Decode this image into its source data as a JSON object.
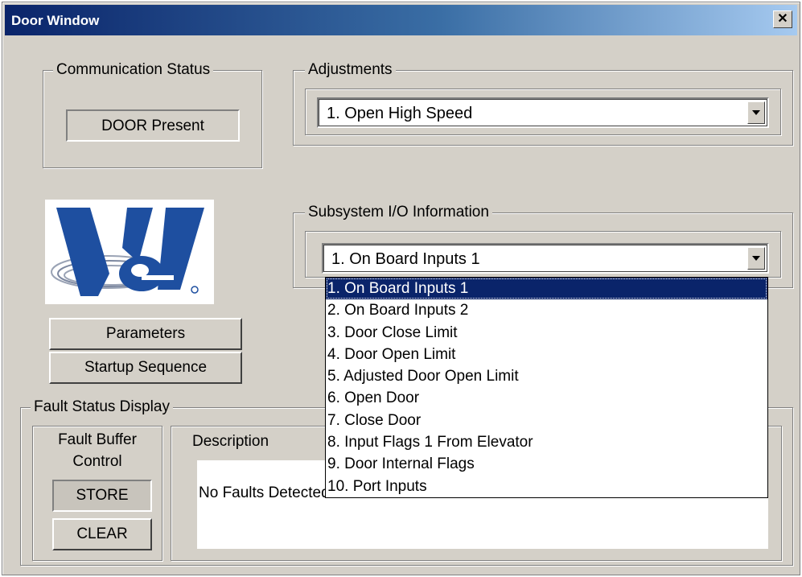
{
  "window": {
    "title": "Door Window",
    "close_symbol": "✕"
  },
  "communication_status": {
    "label": "Communication Status",
    "value": "DOOR Present"
  },
  "adjustments": {
    "label": "Adjustments",
    "selected": "1. Open High Speed"
  },
  "subsystem": {
    "label": "Subsystem I/O Information",
    "selected": "1. On Board Inputs 1",
    "options": [
      "1. On Board Inputs 1",
      "2. On Board Inputs 2",
      "3. Door Close Limit",
      "4. Door Open Limit",
      "5. Adjusted Door Open Limit",
      "6. Open Door",
      "7. Close Door",
      "8. Input Flags 1 From Elevator",
      "9. Door Internal Flags",
      "10. Port Inputs"
    ]
  },
  "buttons": {
    "parameters": "Parameters",
    "startup_sequence": "Startup Sequence"
  },
  "fault_status": {
    "label": "Fault Status Display",
    "buffer_label_line1": "Fault Buffer",
    "buffer_label_line2": "Control",
    "store": "STORE",
    "clear": "CLEAR",
    "description_label": "Description",
    "description_text": "No Faults Detected"
  },
  "colors": {
    "face": "#d4d0c8",
    "title_start": "#0a246a",
    "selection": "#0a246a",
    "logo_blue": "#1e4fa0"
  }
}
